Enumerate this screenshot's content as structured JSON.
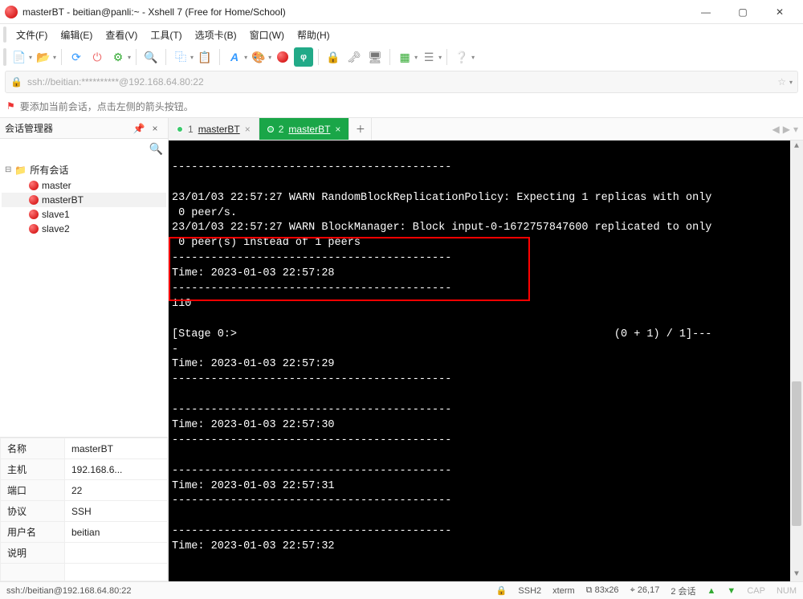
{
  "window": {
    "title": "masterBT - beitian@panli:~ - Xshell 7 (Free for Home/School)"
  },
  "menu": {
    "file": "文件(F)",
    "edit": "编辑(E)",
    "view": "查看(V)",
    "tools": "工具(T)",
    "tab": "选项卡(B)",
    "window": "窗口(W)",
    "help": "帮助(H)"
  },
  "address": {
    "url": "ssh://beitian:**********@192.168.64.80:22"
  },
  "hint": {
    "text": "要添加当前会话，点击左侧的箭头按钮。"
  },
  "sidebar": {
    "title": "会话管理器",
    "root": "所有会话",
    "items": [
      {
        "label": "master"
      },
      {
        "label": "masterBT"
      },
      {
        "label": "slave1"
      },
      {
        "label": "slave2"
      }
    ]
  },
  "props": {
    "name_k": "名称",
    "name_v": "masterBT",
    "host_k": "主机",
    "host_v": "192.168.6...",
    "port_k": "端口",
    "port_v": "22",
    "proto_k": "协议",
    "proto_v": "SSH",
    "user_k": "用户名",
    "user_v": "beitian",
    "desc_k": "说明",
    "desc_v": ""
  },
  "tabs": {
    "t1_num": "1",
    "t1_label": "masterBT",
    "t2_num": "2",
    "t2_label": "masterBT"
  },
  "terminal": {
    "lines": "-------------------------------------------\n\n23/01/03 22:57:27 WARN RandomBlockReplicationPolicy: Expecting 1 replicas with only\n 0 peer/s.\n23/01/03 22:57:27 WARN BlockManager: Block input-0-1672757847600 replicated to only\n 0 peer(s) instead of 1 peers\n-------------------------------------------\nTime: 2023-01-03 22:57:28\n-------------------------------------------\n110\n\n[Stage 0:>                                                          (0 + 1) / 1]---\n-\nTime: 2023-01-03 22:57:29\n-------------------------------------------\n\n-------------------------------------------\nTime: 2023-01-03 22:57:30\n-------------------------------------------\n\n-------------------------------------------\nTime: 2023-01-03 22:57:31\n-------------------------------------------\n\n-------------------------------------------\nTime: 2023-01-03 22:57:32"
  },
  "status": {
    "conn": "ssh://beitian@192.168.64.80:22",
    "proto": "SSH2",
    "term": "xterm",
    "size": "83x26",
    "cursor": "26,17",
    "sessions": "2 会话",
    "cap": "CAP",
    "num": "NUM"
  },
  "icons": {
    "min": "—",
    "max": "▢",
    "close": "✕",
    "pin": "📌",
    "x": "×",
    "plus": "＋",
    "left": "◀",
    "right": "▶",
    "down": "▾"
  }
}
